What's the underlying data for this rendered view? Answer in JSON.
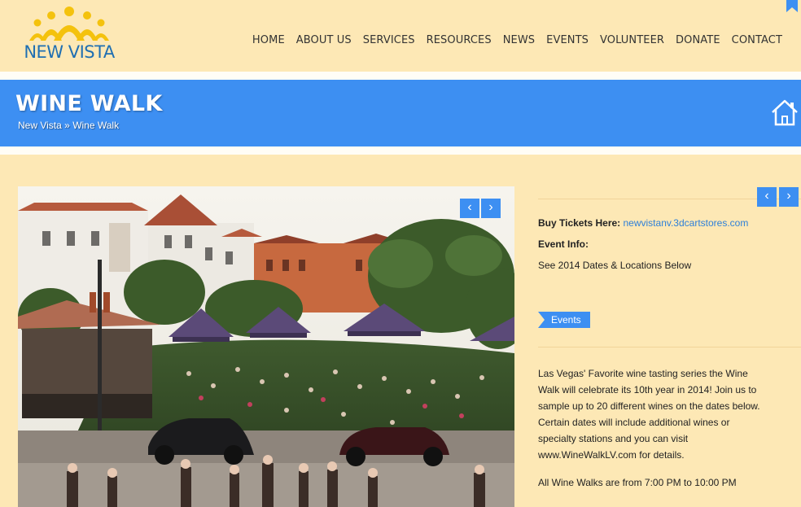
{
  "brand": {
    "logo_text": "NEW VISTA"
  },
  "nav": {
    "items": [
      "HOME",
      "ABOUT US",
      "SERVICES",
      "RESOURCES",
      "NEWS",
      "EVENTS",
      "VOLUNTEER",
      "DONATE",
      "CONTACT"
    ]
  },
  "banner": {
    "title": "WINE WALK",
    "crumb_home": "New Vista",
    "crumb_sep": "»",
    "crumb_current": "Wine Walk"
  },
  "carousel": {
    "prev_label": "‹",
    "next_label": "›"
  },
  "event": {
    "tickets_label": "Buy Tickets Here:",
    "tickets_link": "newvistanv.3dcartstores.com",
    "info_label": "Event Info:",
    "info_value": "See 2014 Dates & Locations Below",
    "tag": "Events",
    "description": "Las Vegas' Favorite wine tasting series the Wine Walk will celebrate its 10th year in 2014! Join us to sample up to 20 different wines on the dates below. Certain dates will include additional wines or specialty stations and you can visit www.WineWalkLV.com for details.",
    "times": "All Wine Walks are from 7:00 PM to 10:00 PM"
  },
  "colors": {
    "background": "#fde8b5",
    "accent_blue": "#3d8ff2",
    "logo_yellow": "#f4c20d",
    "logo_blue": "#1f6fb2"
  }
}
